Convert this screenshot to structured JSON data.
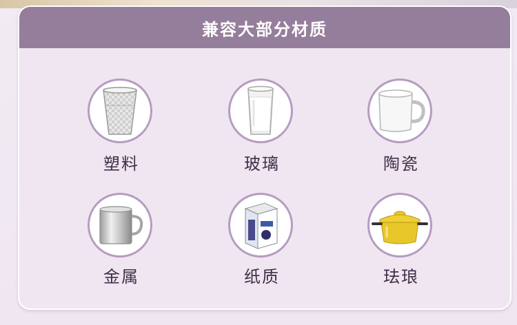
{
  "title": "兼容大部分材质",
  "materials": [
    {
      "label": "塑料",
      "icon": "plastic-cup-icon"
    },
    {
      "label": "玻璃",
      "icon": "glass-cup-icon"
    },
    {
      "label": "陶瓷",
      "icon": "ceramic-mug-icon"
    },
    {
      "label": "金属",
      "icon": "metal-mug-icon"
    },
    {
      "label": "纸质",
      "icon": "paper-carton-icon"
    },
    {
      "label": "珐琅",
      "icon": "enamel-pot-icon"
    }
  ],
  "colors": {
    "header_bg": "#957e9b",
    "card_bg": "#f0e6f1",
    "circle_border": "#b59cc0",
    "label_text": "#3f2f48",
    "pot_yellow": "#e8c72a"
  }
}
